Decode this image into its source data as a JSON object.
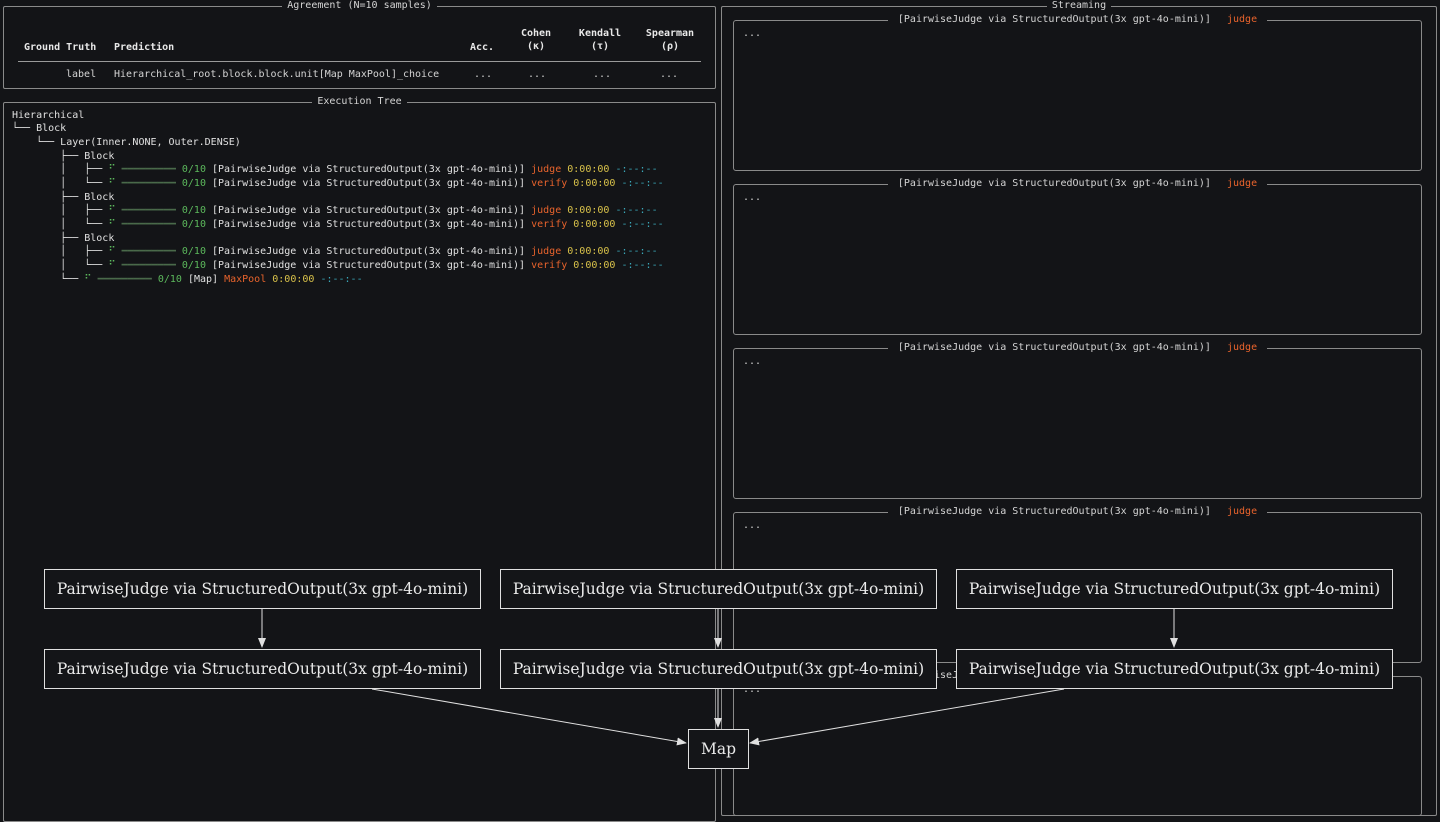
{
  "agreement": {
    "title": "Agreement (N=10 samples)",
    "headers": {
      "ground_truth": "Ground Truth",
      "prediction": "Prediction",
      "acc": "Acc.",
      "cohen": "Cohen",
      "cohen_sym": "(κ)",
      "kendall": "Kendall",
      "kendall_sym": "(τ)",
      "spearman": "Spearman",
      "spearman_sym": "(ρ)"
    },
    "row": {
      "ground_truth": "label",
      "prediction": "Hierarchical_root.block.block.unit[Map MaxPool]_choice",
      "acc": "...",
      "cohen": "...",
      "kendall": "...",
      "spearman": "..."
    }
  },
  "tree": {
    "title": "Execution Tree",
    "root": "Hierarchical",
    "block": "Block",
    "layer": "Layer(Inner.NONE, Outer.DENSE)",
    "sub_block": "Block",
    "spinner": "⠋",
    "progress": "0/10",
    "pairwise": "[PairwiseJudge via StructuredOutput(3x gpt-4o-mini)]",
    "judge": "judge",
    "verify": "verify",
    "elapsed": "0:00:00",
    "remaining": "-:--:--",
    "map": "[Map]",
    "maxpool": "MaxPool"
  },
  "streaming": {
    "title": "Streaming",
    "box_title": "[PairwiseJudge via StructuredOutput(3x gpt-4o-mini)]",
    "box_tag": "judge",
    "placeholder": "..."
  },
  "diagram": {
    "nodes": [
      "PairwiseJudge via StructuredOutput(3x gpt-4o-mini)",
      "PairwiseJudge via StructuredOutput(3x gpt-4o-mini)",
      "PairwiseJudge via StructuredOutput(3x gpt-4o-mini)",
      "PairwiseJudge via StructuredOutput(3x gpt-4o-mini)",
      "PairwiseJudge via StructuredOutput(3x gpt-4o-mini)",
      "PairwiseJudge via StructuredOutput(3x gpt-4o-mini)"
    ],
    "map": "Map"
  },
  "colors": {
    "background": "#131417",
    "green": "#5cb85c",
    "yellow": "#d9c24a",
    "orange": "#e8632c",
    "cyan": "#3aa7b8"
  }
}
